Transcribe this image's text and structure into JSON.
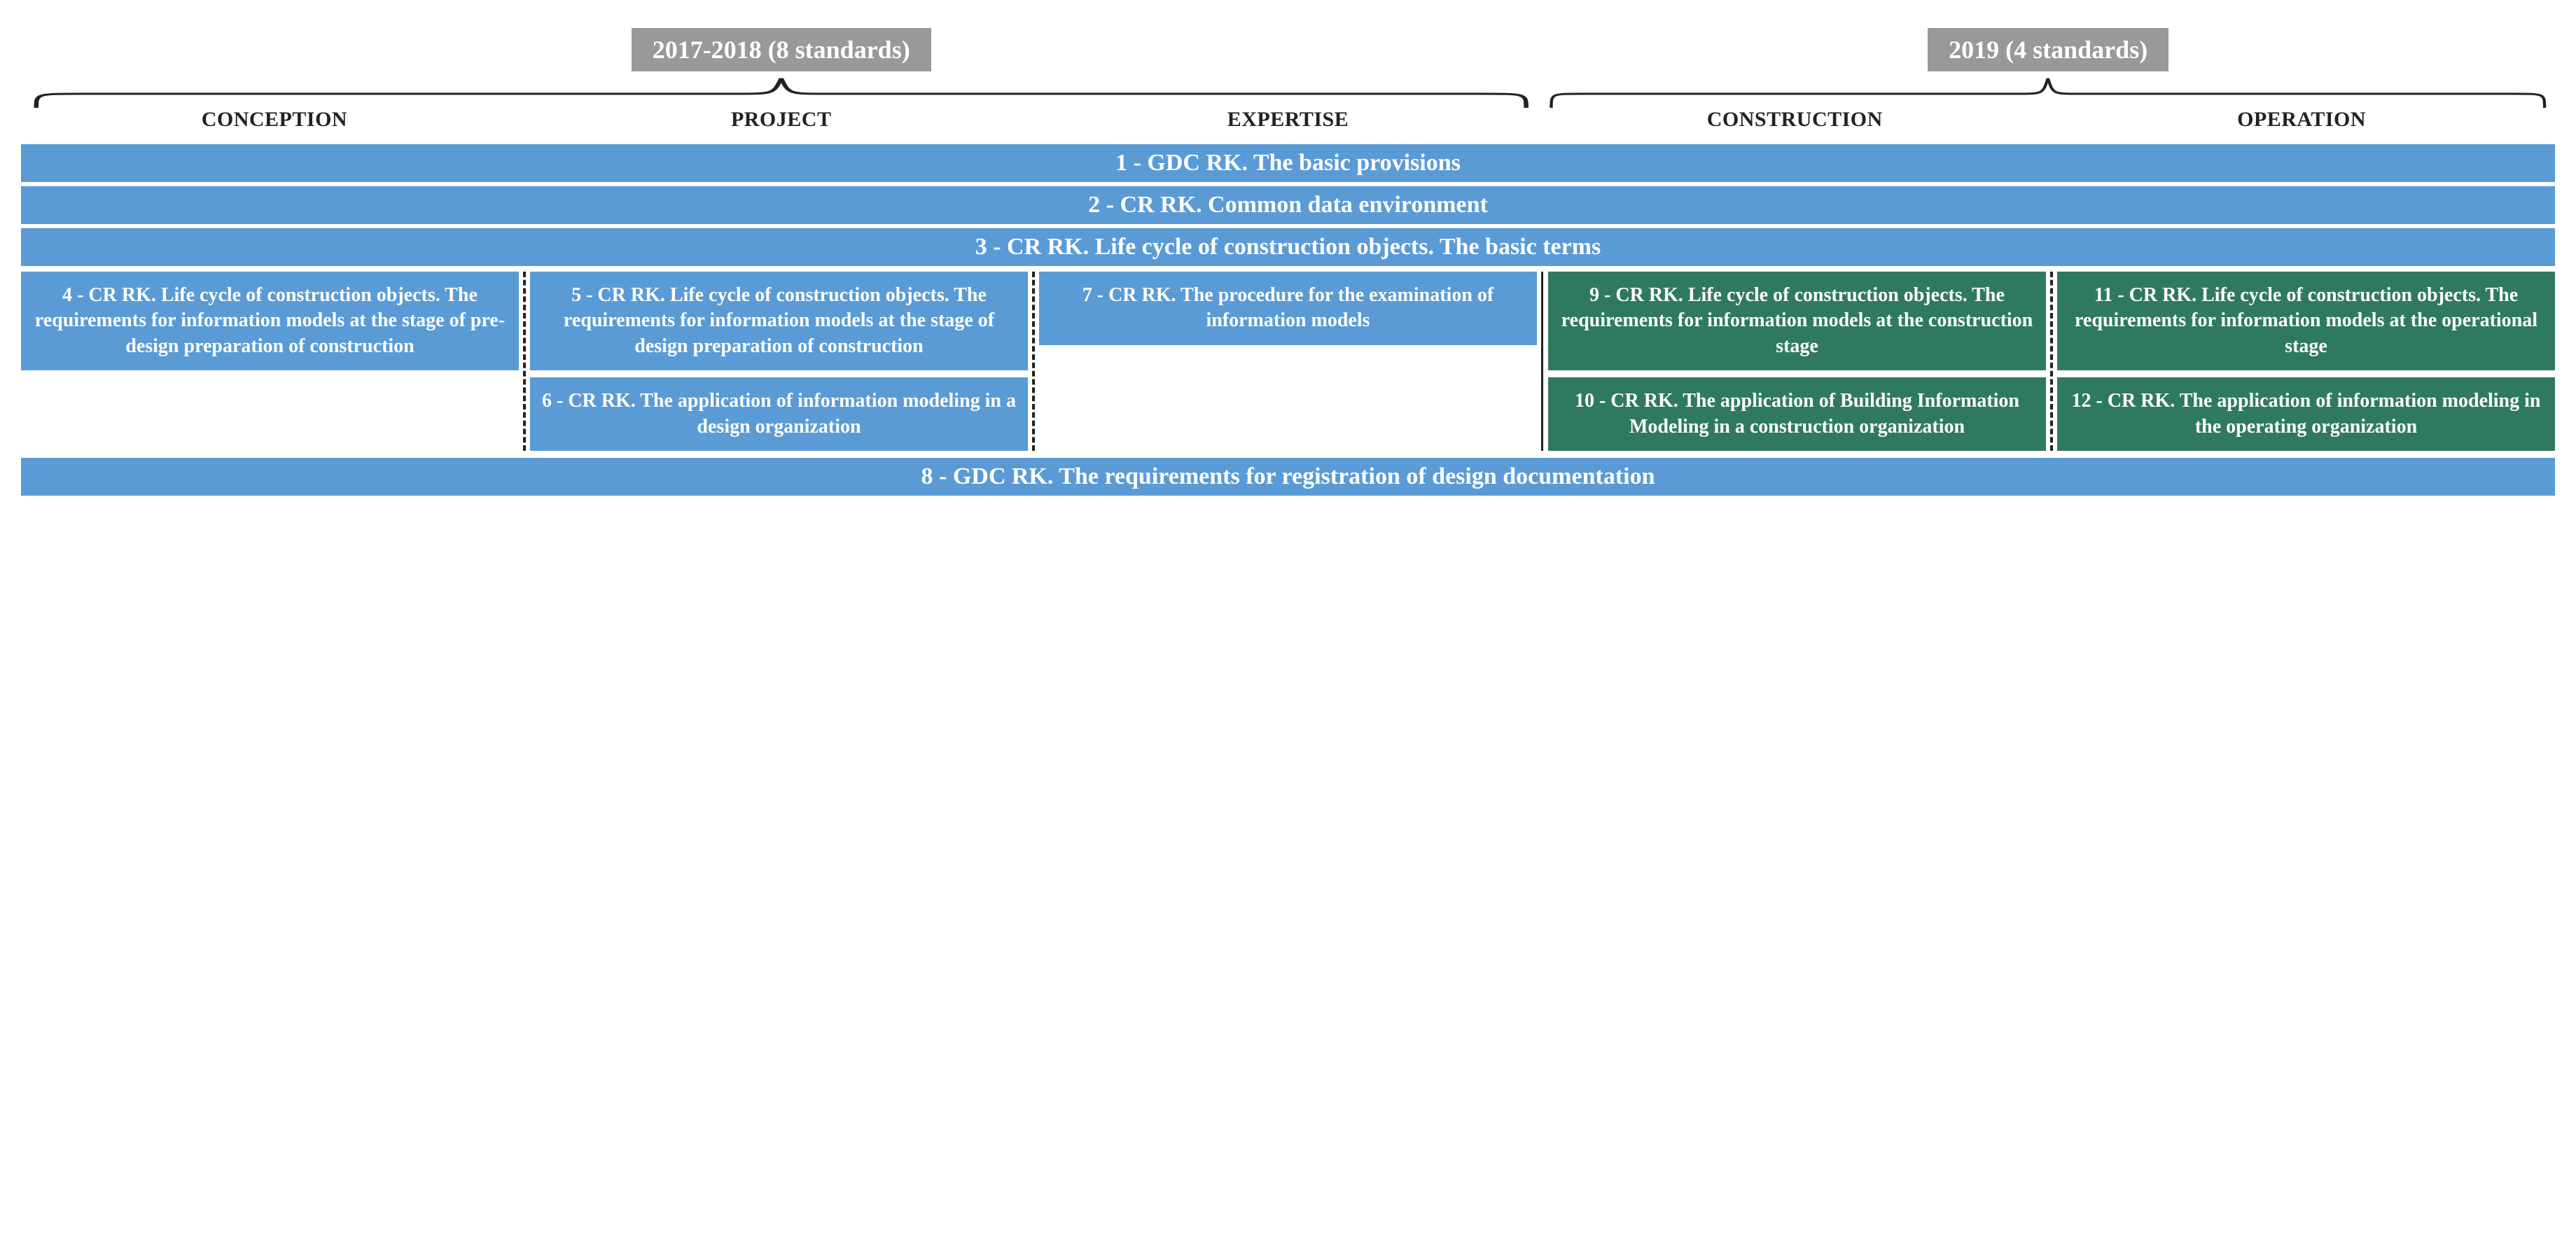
{
  "periods": {
    "left": "2017-2018 (8 standards)",
    "right": "2019 (4 standards)"
  },
  "phases": {
    "conception": "CONCEPTION",
    "project": "PROJECT",
    "expertise": "EXPERTISE",
    "construction": "CONSTRUCTION",
    "operation": "OPERATION"
  },
  "bands": {
    "b1": "1 - GDC RK. The basic provisions",
    "b2": "2 - CR RK. Common data environment",
    "b3": "3 - CR RK. Life cycle of construction objects. The basic terms",
    "b8": "8 - GDC RK. The requirements for registration of design documentation"
  },
  "cards": {
    "c4": "4 - CR RK. Life cycle of construction objects. The requirements for information models at the stage of pre-design preparation of construction",
    "c5": "5 - CR RK. Life cycle of construction objects. The requirements for information models at the stage of design preparation of construction",
    "c6": "6 - CR RK. The application of information modeling in a design organization",
    "c7": "7 - CR RK. The procedure for the examination of information models",
    "c9": "9 - CR RK. Life cycle of construction objects. The requirements for information models at the construction stage",
    "c10": "10 - CR RK. The application of Building Information Modeling in a construction organization",
    "c11": "11 - CR RK. Life cycle of construction objects. The requirements for information models at the operational stage",
    "c12": "12 - CR RK. The application of information modeling in the operating organization"
  }
}
